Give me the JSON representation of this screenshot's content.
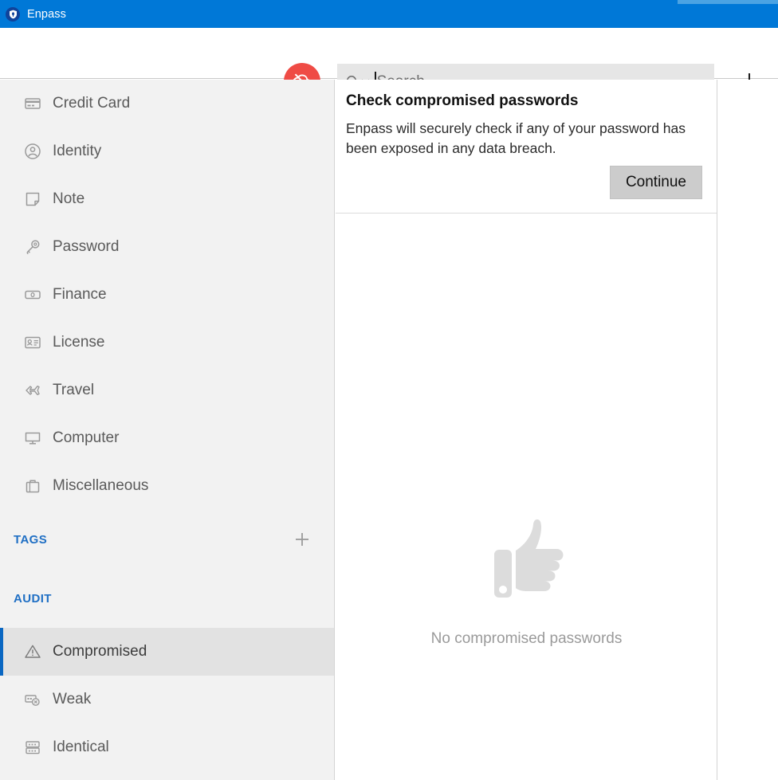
{
  "titlebar": {
    "app_name": "Enpass",
    "logo_icon": "shield-icon",
    "bg_color": "#0078d7"
  },
  "toolbar": {
    "sync_status_icon": "cloud-off-icon",
    "sync_status_color": "#ef4b45",
    "search": {
      "icon": "search-icon",
      "dropdown_icon": "chevron-down-icon",
      "value": "",
      "placeholder": "Search"
    },
    "add_button_icon": "plus-icon"
  },
  "sidebar": {
    "categories": [
      {
        "label": "Credit Card",
        "icon": "credit-card-icon"
      },
      {
        "label": "Identity",
        "icon": "person-circle-icon"
      },
      {
        "label": "Note",
        "icon": "note-icon"
      },
      {
        "label": "Password",
        "icon": "key-icon"
      },
      {
        "label": "Finance",
        "icon": "banknote-icon"
      },
      {
        "label": "License",
        "icon": "id-card-icon"
      },
      {
        "label": "Travel",
        "icon": "airplane-icon"
      },
      {
        "label": "Computer",
        "icon": "monitor-icon"
      },
      {
        "label": "Miscellaneous",
        "icon": "briefcase-icon"
      }
    ],
    "tags_section": {
      "title": "TAGS",
      "add_icon": "plus-icon",
      "color": "#1f6fc4"
    },
    "audit_section": {
      "title": "AUDIT",
      "color": "#1f6fc4",
      "items": [
        {
          "label": "Compromised",
          "icon": "warning-triangle-icon",
          "selected": true
        },
        {
          "label": "Weak",
          "icon": "weak-password-icon",
          "selected": false
        },
        {
          "label": "Identical",
          "icon": "identical-rows-icon",
          "selected": false
        }
      ]
    },
    "selection_accent": "#0a67c2"
  },
  "main": {
    "banner": {
      "title": "Check compromised passwords",
      "description": "Enpass will securely check if any of your password has been exposed in any data breach.",
      "continue_label": "Continue"
    },
    "empty_state": {
      "icon": "thumbs-up-icon",
      "message": "No compromised passwords"
    }
  }
}
